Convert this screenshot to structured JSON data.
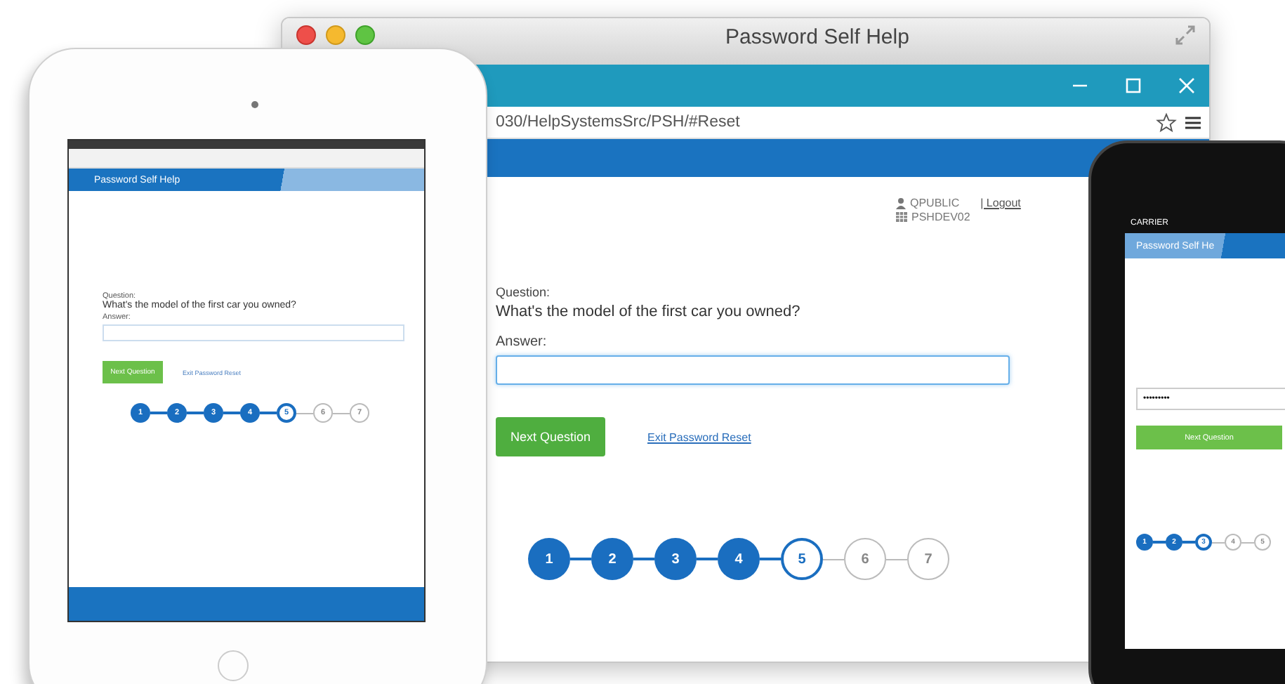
{
  "browser": {
    "title": "Password Self Help",
    "url": "030/HelpSystemsSrc/PSH/#Reset",
    "user": "QPUBLIC",
    "logout": "| Logout",
    "system": "PSHDEV02",
    "question_label": "Question:",
    "question": "What's the model of the first car you owned?",
    "answer_label": "Answer:",
    "next_button": "Next Question",
    "exit_link": "Exit Password Reset",
    "steps": [
      {
        "label": "1",
        "completed": true,
        "current": false
      },
      {
        "label": "2",
        "completed": true,
        "current": false
      },
      {
        "label": "3",
        "completed": true,
        "current": false
      },
      {
        "label": "4",
        "completed": true,
        "current": false
      },
      {
        "label": "5",
        "completed": false,
        "current": true
      },
      {
        "label": "6",
        "completed": false,
        "current": false
      },
      {
        "label": "7",
        "completed": false,
        "current": false
      }
    ]
  },
  "tablet": {
    "header": "Password Self Help",
    "question_label": "Question:",
    "question": "What's the model of the first car you owned?",
    "answer_label": "Answer:",
    "next_button": "Next Question",
    "exit_link": "Exit Password Reset",
    "steps": [
      {
        "label": "1",
        "completed": true,
        "current": false
      },
      {
        "label": "2",
        "completed": true,
        "current": false
      },
      {
        "label": "3",
        "completed": true,
        "current": false
      },
      {
        "label": "4",
        "completed": true,
        "current": false
      },
      {
        "label": "5",
        "completed": false,
        "current": true
      },
      {
        "label": "6",
        "completed": false,
        "current": false
      },
      {
        "label": "7",
        "completed": false,
        "current": false
      }
    ]
  },
  "phone": {
    "carrier": "CARRIER",
    "header": "Password Self He",
    "answer_value": "•••••••••",
    "next_button": "Next Question",
    "steps": [
      {
        "label": "1",
        "completed": true,
        "current": false
      },
      {
        "label": "2",
        "completed": true,
        "current": false
      },
      {
        "label": "3",
        "completed": false,
        "current": true
      },
      {
        "label": "4",
        "completed": false,
        "current": false
      },
      {
        "label": "5",
        "completed": false,
        "current": false
      }
    ]
  }
}
